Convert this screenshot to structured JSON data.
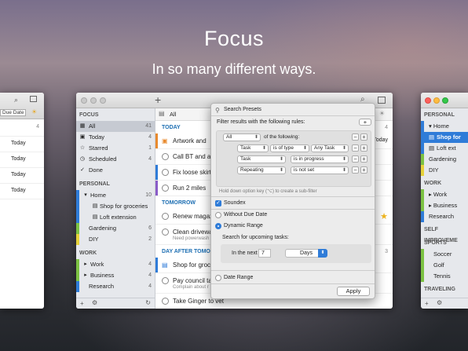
{
  "hero": {
    "title": "Focus",
    "subtitle": "In so many different ways."
  },
  "left_window": {
    "col_header": "Due Date",
    "rows": [
      {
        "due": "4"
      },
      {
        "due": "Today"
      },
      {
        "due": "Today"
      },
      {
        "due": "Today"
      },
      {
        "due": "Today"
      }
    ]
  },
  "main_window": {
    "toolbar": {
      "add": "+",
      "filter": "All"
    },
    "sidebar": {
      "focus_header": "FOCUS",
      "focus_items": [
        {
          "label": "All",
          "count": "41"
        },
        {
          "label": "Today",
          "count": "4"
        },
        {
          "label": "Starred",
          "count": "1"
        },
        {
          "label": "Scheduled",
          "count": "4"
        },
        {
          "label": "Done",
          "count": ""
        }
      ],
      "personal_header": "PERSONAL",
      "personal_items": [
        {
          "label": "Home",
          "count": "10"
        },
        {
          "label": "Shop for groceries",
          "count": ""
        },
        {
          "label": "Loft extension",
          "count": ""
        },
        {
          "label": "Gardening",
          "count": "6"
        },
        {
          "label": "DIY",
          "count": "2"
        }
      ],
      "work_header": "WORK",
      "work_items": [
        {
          "label": "Work",
          "count": "4"
        },
        {
          "label": "Business",
          "count": "4"
        },
        {
          "label": "Research",
          "count": "4"
        }
      ]
    },
    "groups": [
      {
        "title": "TODAY",
        "count": "4",
        "tasks": [
          {
            "title": "Artwork and",
            "due": "Today"
          },
          {
            "title": "Call BT and ask",
            "due": ""
          },
          {
            "title": "Fix loose skirtin",
            "due": ""
          },
          {
            "title": "Run 2 miles",
            "due": ""
          }
        ]
      },
      {
        "title": "TOMORROW",
        "count": "",
        "tasks": [
          {
            "title": "Renew magazin",
            "sub": ""
          },
          {
            "title": "Clean driveway",
            "sub": "Need powerwash"
          }
        ]
      },
      {
        "title": "DAY AFTER TOMORR",
        "count": "3",
        "tasks": [
          {
            "title": "Shop for groc",
            "sub": ""
          },
          {
            "title": "Pay council tax",
            "sub": "Complain about r"
          },
          {
            "title": "Take Ginger to vet",
            "sub": ""
          }
        ]
      }
    ]
  },
  "presets": {
    "title": "Search Presets",
    "intro": "Filter results with the following rules:",
    "match_select": "All",
    "match_suffix": "of the following:",
    "rules": [
      {
        "field": "Task",
        "op": "is of type",
        "value": "Any Task"
      },
      {
        "field": "Task",
        "op": "is in progress",
        "value": ""
      },
      {
        "field": "Repeating",
        "op": "is not set",
        "value": ""
      }
    ],
    "hint": "Hold down option key (⌥) to create a sub-filter",
    "soundex": "Soundex",
    "without_due": "Without Due Date",
    "dynamic_range": "Dynamic Range",
    "upcoming_label": "Search for upcoming tasks:",
    "in_the_next": "In the next",
    "next_value": "7",
    "next_unit": "Days",
    "date_range": "Date Range",
    "apply": "Apply"
  },
  "right_window": {
    "sections": [
      {
        "header": "PERSONAL",
        "items": [
          "Home",
          "Shop for",
          "Loft ext",
          "Gardening",
          "DIY"
        ]
      },
      {
        "header": "WORK",
        "items": [
          "Work",
          "Business",
          "Research"
        ]
      },
      {
        "header": "SELF IMPROVEME",
        "items": []
      },
      {
        "header": "SPORTS",
        "items": [
          "Soccer",
          "Golf",
          "Tennis"
        ]
      },
      {
        "header": "TRAVELING",
        "items": []
      }
    ]
  },
  "colors": {
    "blue": "#2f7cd8",
    "green": "#7cc243",
    "yellow": "#e6d23a",
    "purple": "#8a5cc8",
    "orange": "#e88a2e",
    "red": "#e0453c"
  }
}
